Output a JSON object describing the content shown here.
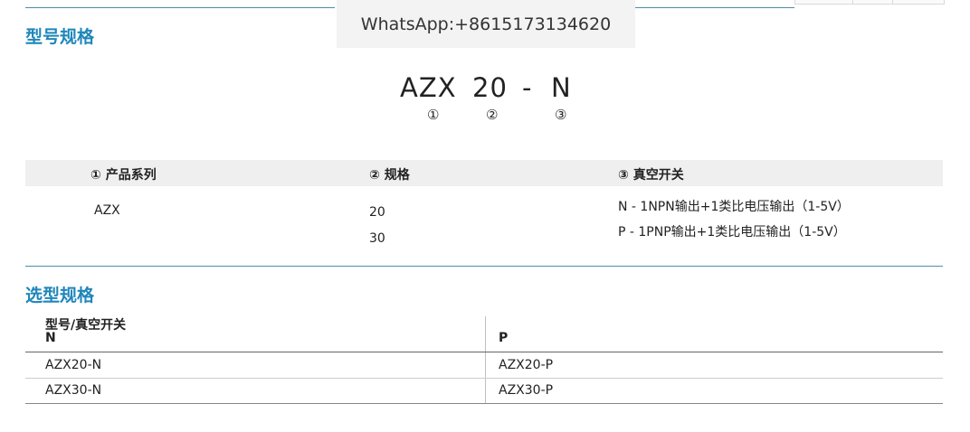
{
  "watermark": "WhatsApp:+8615173134620",
  "section1": {
    "title": "型号规格"
  },
  "model_code": {
    "parts": [
      "AZX",
      "20",
      "-",
      "N"
    ],
    "markers": [
      "①",
      "②",
      "③"
    ]
  },
  "spec_table": {
    "headers": [
      "① 产品系列",
      "② 规格",
      "③ 真空开关"
    ],
    "series": "AZX",
    "sizes": [
      "20",
      "30"
    ],
    "switch_options": [
      "N - 1NPN输出+1类比电压输出（1-5V）",
      "P - 1PNP输出+1类比电压输出（1-5V）"
    ]
  },
  "section2": {
    "title": "选型规格"
  },
  "selection_table": {
    "header_title": "型号/真空开关",
    "columns": [
      "N",
      "P"
    ],
    "rows": [
      [
        "AZX20-N",
        "AZX20-P"
      ],
      [
        "AZX30-N",
        "AZX30-P"
      ]
    ]
  },
  "colors": {
    "accent": "#1f86ba",
    "rule": "#4a8fa8",
    "header_bg": "#efefef"
  }
}
